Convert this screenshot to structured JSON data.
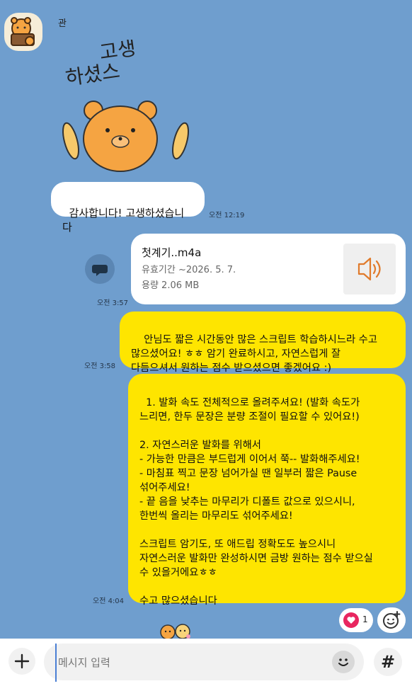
{
  "chat": {
    "sender_name": "관",
    "sticker_text": "고생하셨스",
    "messages": {
      "thanks": {
        "text": "감사합니다! 고생하셨습니다",
        "time": "오전 12:19"
      },
      "file": {
        "name": "첫계기..m4a",
        "expiry": "유효기간 ~2026. 5. 7.",
        "size": "용량  2.06 MB",
        "time": "오전 3:57"
      },
      "msg1": {
        "text": "  안님도 짧은 시간동안 많은 스크립트 학습하시느라 수고\n많으셨어요! ㅎㅎ 암기 완료하시고, 자연스럽게 잘\n다듬으셔서 원하는 점수 받으셨으면 좋겠어요 :)",
        "time": "오전 3:58"
      },
      "msg2": {
        "text": "1. 발화 속도 전체적으로 올려주셔요! (발화 속도가\n느리면, 한두 문장은 분량 조절이 필요할 수 있어요!)\n\n2. 자연스러운 발화를 위해서\n- 가능한 만큼은 부드럽게 이어서 쭉-- 발화해주세요!\n- 마침표 찍고 문장 넘어가실 땐 일부러 짧은 Pause\n섞어주세요!\n- 끝 음을 낮추는 마무리가 디폴트 값으로 있으시니,\n한번씩 올리는 마무리도 섞어주세요!\n\n스크립트 암기도, 또 애드립 정확도도 높으시니\n자연스러운 발화만 완성하시면 금방 원하는 점수 받으실\n수 있을거에요ㅎㅎ\n\n수고 많으셨습니다",
        "time": "오전 4:04"
      }
    },
    "reaction": {
      "heart_count": "1"
    }
  },
  "input": {
    "placeholder": "메시지 입력"
  },
  "icons": {
    "share": "share-speech-icon",
    "audio": "speaker-icon",
    "heart": "heart-icon",
    "add_reaction": "add-emoji-icon",
    "plus": "plus-icon",
    "emoji": "emoji-icon",
    "hash": "hash-icon"
  },
  "colors": {
    "background": "#6f9ece",
    "my_bubble": "#fee500",
    "their_bubble": "#ffffff",
    "heart": "#e8265f",
    "audio_icon": "#e07a2b"
  }
}
